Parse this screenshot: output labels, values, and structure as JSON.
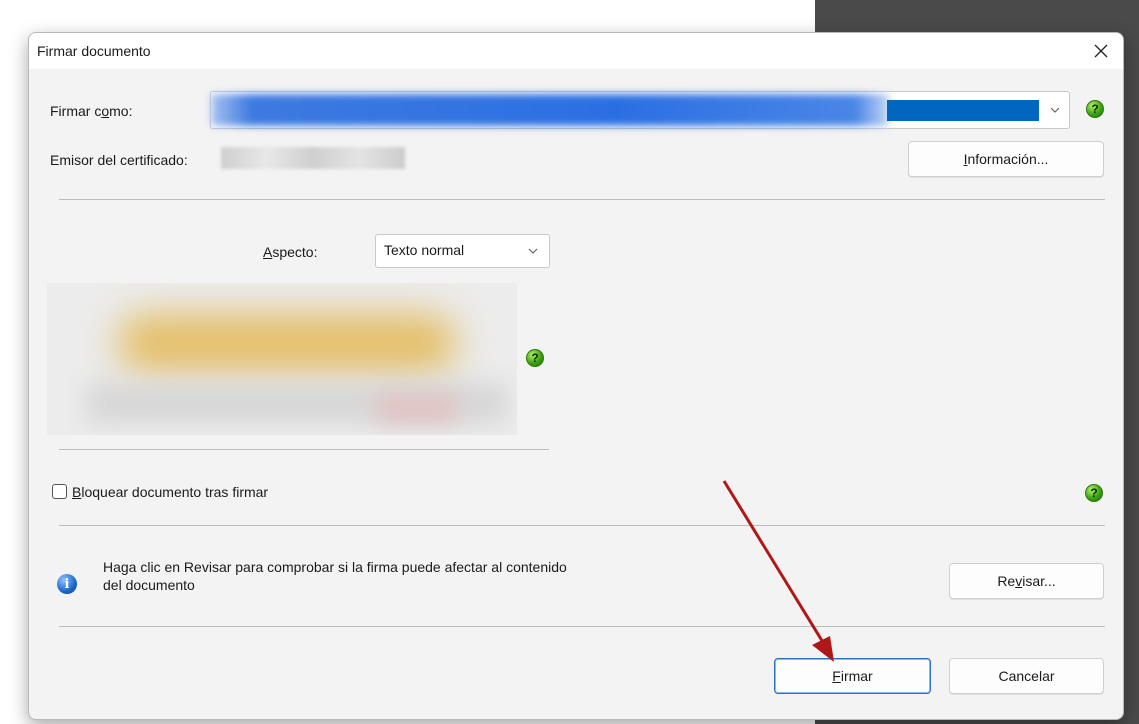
{
  "dialog": {
    "title": "Firmar documento"
  },
  "sign_as": {
    "label_pre": "Firmar c",
    "label_u": "o",
    "label_post": "mo:"
  },
  "issuer": {
    "label": "Emisor del certificado:",
    "info_button_u": "I",
    "info_button_rest": "nformación..."
  },
  "appearance": {
    "label_u": "A",
    "label_rest": "specto:",
    "selected": "Texto normal"
  },
  "lock": {
    "label_u": "B",
    "label_rest": "loquear documento tras firmar",
    "checked": false
  },
  "review": {
    "text_line1": "Haga clic en Revisar para comprobar si la firma puede afectar al contenido",
    "text_line2": "del documento",
    "button_pre": "Re",
    "button_u": "v",
    "button_post": "isar..."
  },
  "footer": {
    "sign_u": "F",
    "sign_rest": "irmar",
    "cancel_label": "Cancelar"
  },
  "colors": {
    "accent": "#0067c0",
    "help_green": "#3aa40e",
    "arrow_red": "#b01818"
  }
}
